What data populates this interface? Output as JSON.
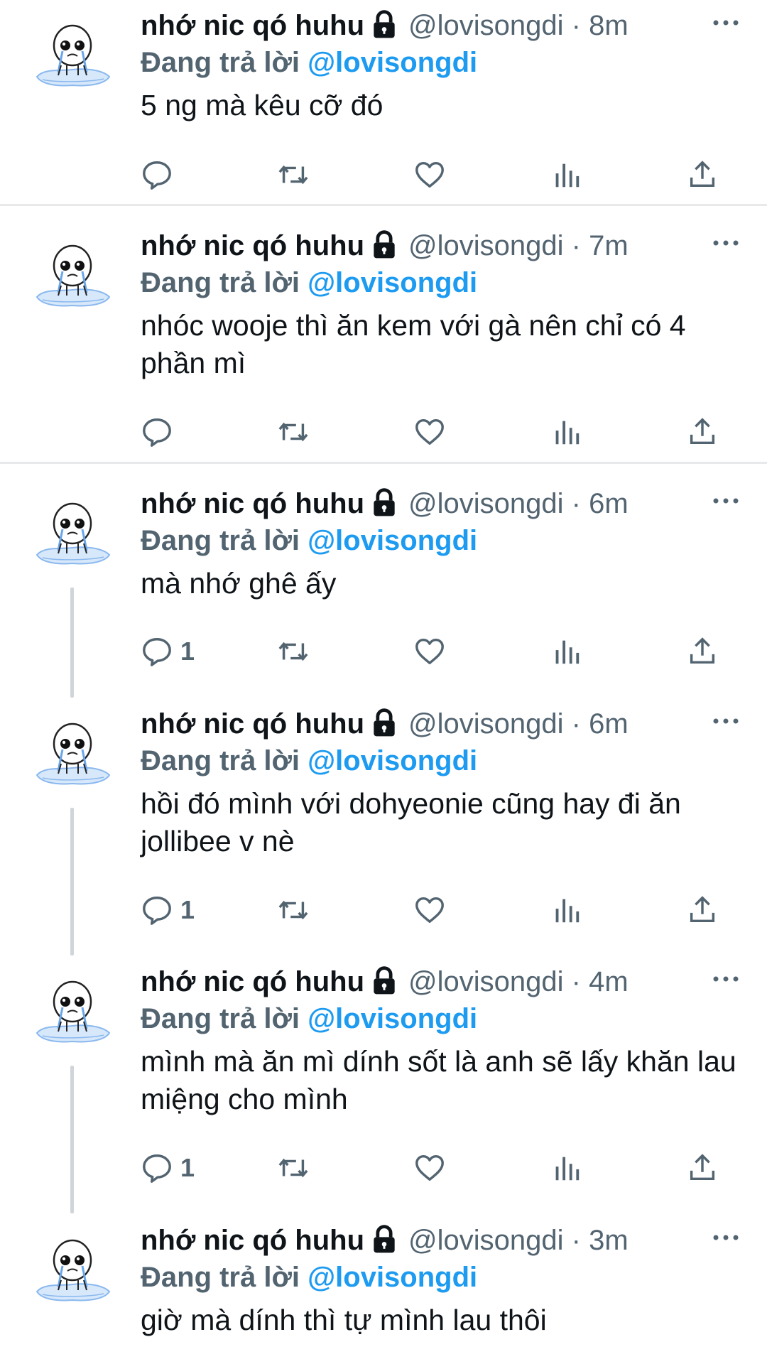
{
  "tweets": [
    {
      "name": "nhớ nic qó huhu",
      "handle": "@lovisongdi",
      "dot": " · ",
      "time": "8m",
      "reply_prefix": "Đang trả lời ",
      "reply_to": "@lovisongdi",
      "text": "5 ng mà kêu cỡ đó",
      "reply_count": ""
    },
    {
      "name": "nhớ nic qó huhu",
      "handle": "@lovisongdi",
      "dot": " · ",
      "time": "7m",
      "reply_prefix": "Đang trả lời ",
      "reply_to": "@lovisongdi",
      "text": "nhóc wooje thì ăn kem với gà nên chỉ có 4 phần mì",
      "reply_count": ""
    },
    {
      "name": "nhớ nic qó huhu",
      "handle": "@lovisongdi",
      "dot": " · ",
      "time": "6m",
      "reply_prefix": "Đang trả lời ",
      "reply_to": "@lovisongdi",
      "text": "mà nhớ ghê ấy",
      "reply_count": "1"
    },
    {
      "name": "nhớ nic qó huhu",
      "handle": "@lovisongdi",
      "dot": " · ",
      "time": "6m",
      "reply_prefix": "Đang trả lời ",
      "reply_to": "@lovisongdi",
      "text": "hồi đó mình với dohyeonie cũng hay đi ăn jollibee v nè",
      "reply_count": "1"
    },
    {
      "name": "nhớ nic qó huhu",
      "handle": "@lovisongdi",
      "dot": " · ",
      "time": "4m",
      "reply_prefix": "Đang trả lời ",
      "reply_to": "@lovisongdi",
      "text": "mình mà ăn mì dính sốt là anh sẽ lấy khăn lau miệng cho mình",
      "reply_count": "1"
    },
    {
      "name": "nhớ nic qó huhu",
      "handle": "@lovisongdi",
      "dot": " · ",
      "time": "3m",
      "reply_prefix": "Đang trả lời ",
      "reply_to": "@lovisongdi",
      "text": "giờ mà dính thì tự mình lau thôi",
      "reply_count": ""
    }
  ],
  "icons": {
    "avatar": "crying-doodle-avatar",
    "lock": "lock-icon",
    "more": "more-icon",
    "reply": "reply-icon",
    "retweet": "retweet-icon",
    "like": "heart-icon",
    "views": "views-icon",
    "share": "share-icon"
  },
  "colors": {
    "mention": "#1d9bf0",
    "secondary": "#536471",
    "text": "#0f1419",
    "separator": "#e7e9eb"
  }
}
